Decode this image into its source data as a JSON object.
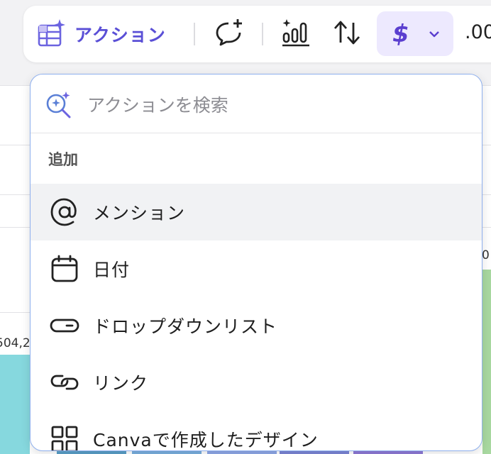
{
  "toolbar": {
    "action_label": "アクション",
    "currency_symbol": "$",
    "decimal_text": ".00"
  },
  "search": {
    "placeholder": "アクションを検索"
  },
  "section": {
    "label": "追加"
  },
  "items": [
    {
      "label": "メンション",
      "icon": "at-icon"
    },
    {
      "label": "日付",
      "icon": "calendar-icon"
    },
    {
      "label": "ドロップダウンリスト",
      "icon": "dropdown-list-icon"
    },
    {
      "label": "リンク",
      "icon": "link-icon"
    },
    {
      "label": "Canvaで作成したデザイン",
      "icon": "design-grid-icon"
    }
  ],
  "background": {
    "cell_left": "504,2",
    "cell_right": "0"
  },
  "colors": {
    "accent": "#5a4fd6",
    "currency_bg": "#ede9fe",
    "panel_border": "#8fb0ee",
    "hover_bg": "#f1f2f4"
  }
}
